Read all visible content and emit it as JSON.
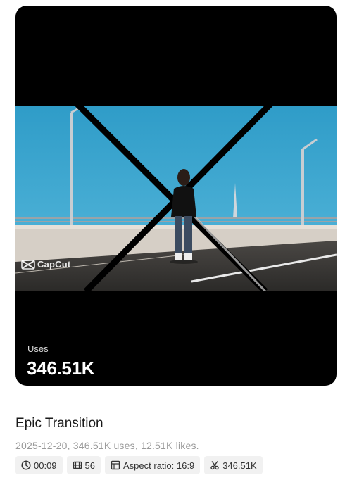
{
  "card": {
    "watermark": "CapCut",
    "uses_label": "Uses",
    "uses_value": "346.51K"
  },
  "template": {
    "title": "Epic Transition",
    "meta": "2025-12-20, 346.51K uses, 12.51K likes."
  },
  "chips": {
    "duration": {
      "icon": "clock-icon",
      "label": "00:09"
    },
    "clips": {
      "icon": "film-icon",
      "label": "56"
    },
    "aspect": {
      "icon": "layout-icon",
      "label": "Aspect ratio: 16:9"
    },
    "uses": {
      "icon": "scissors-icon",
      "label": "346.51K"
    }
  },
  "colors": {
    "card_background": "#000000",
    "sky": "#3aa6cf",
    "chip_background": "#f1f1f1",
    "meta_text": "#9a9a9a"
  }
}
